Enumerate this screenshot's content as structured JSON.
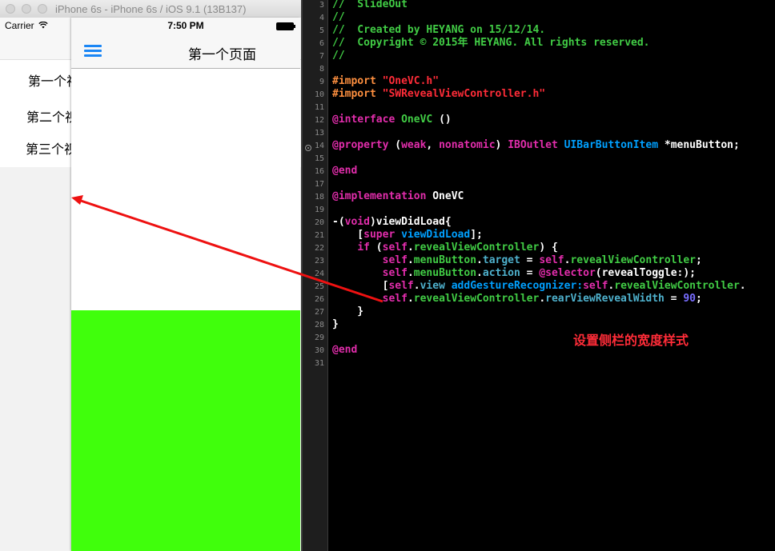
{
  "simulator": {
    "window_title": "iPhone 6s - iPhone 6s / iOS 9.1 (13B137)",
    "carrier": "Carrier",
    "time": "7:50 PM",
    "menu_items": [
      "第一个视",
      "第二个视",
      "第三个视"
    ],
    "nav_title": "第一个页面",
    "green_color": "#40ff0c",
    "menu_icon": "hamburger-menu-icon",
    "wifi_icon": "wifi-icon",
    "battery_icon": "battery-icon"
  },
  "editor": {
    "line_numbers": [
      "3",
      "4",
      "5",
      "6",
      "7",
      "8",
      "9",
      "10",
      "11",
      "12",
      "13",
      "14",
      "15",
      "16",
      "17",
      "18",
      "19",
      "20",
      "21",
      "22",
      "23",
      "24",
      "25",
      "26",
      "27",
      "28",
      "29",
      "30",
      "31"
    ],
    "lines": [
      [
        {
          "t": "//  SlideOut",
          "k": "c"
        }
      ],
      [
        {
          "t": "//",
          "k": "c"
        }
      ],
      [
        {
          "t": "//  Created by HEYANG on 15/12/14.",
          "k": "c"
        }
      ],
      [
        {
          "t": "//  Copyright © 2015年 HEYANG. All rights reserved.",
          "k": "c"
        }
      ],
      [
        {
          "t": "//",
          "k": "c"
        }
      ],
      [],
      [
        {
          "t": "#import ",
          "k": "pp"
        },
        {
          "t": "\"OneVC.h\"",
          "k": "st"
        }
      ],
      [
        {
          "t": "#import ",
          "k": "pp"
        },
        {
          "t": "\"SWRevealViewController.h\"",
          "k": "st"
        }
      ],
      [],
      [
        {
          "t": "@interface",
          "k": "kw"
        },
        {
          "t": " ",
          "k": "pl"
        },
        {
          "t": "OneVC",
          "k": "gr"
        },
        {
          "t": " ()",
          "k": "pl"
        }
      ],
      [],
      [
        {
          "t": "@property",
          "k": "kw"
        },
        {
          "t": " (",
          "k": "pl"
        },
        {
          "t": "weak",
          "k": "kw"
        },
        {
          "t": ", ",
          "k": "pl"
        },
        {
          "t": "nonatomic",
          "k": "kw"
        },
        {
          "t": ") ",
          "k": "pl"
        },
        {
          "t": "IBOutlet",
          "k": "kw"
        },
        {
          "t": " ",
          "k": "pl"
        },
        {
          "t": "UIBarButtonItem",
          "k": "cl"
        },
        {
          "t": " *menuButton;",
          "k": "pl"
        }
      ],
      [],
      [
        {
          "t": "@end",
          "k": "kw"
        }
      ],
      [],
      [
        {
          "t": "@implementation",
          "k": "kw"
        },
        {
          "t": " OneVC",
          "k": "pl"
        }
      ],
      [],
      [
        {
          "t": "-(",
          "k": "pl"
        },
        {
          "t": "void",
          "k": "kw"
        },
        {
          "t": ")viewDidLoad{",
          "k": "pl"
        }
      ],
      [
        {
          "t": "    [",
          "k": "pl"
        },
        {
          "t": "super",
          "k": "kw"
        },
        {
          "t": " ",
          "k": "pl"
        },
        {
          "t": "viewDidLoad",
          "k": "cl"
        },
        {
          "t": "];",
          "k": "pl"
        }
      ],
      [
        {
          "t": "    ",
          "k": "pl"
        },
        {
          "t": "if",
          "k": "kw"
        },
        {
          "t": " (",
          "k": "pl"
        },
        {
          "t": "self",
          "k": "kw"
        },
        {
          "t": ".",
          "k": "pl"
        },
        {
          "t": "revealViewController",
          "k": "gr"
        },
        {
          "t": ") {",
          "k": "pl"
        }
      ],
      [
        {
          "t": "        ",
          "k": "pl"
        },
        {
          "t": "self",
          "k": "kw"
        },
        {
          "t": ".",
          "k": "pl"
        },
        {
          "t": "menuButton",
          "k": "gr"
        },
        {
          "t": ".",
          "k": "pl"
        },
        {
          "t": "target",
          "k": "tp"
        },
        {
          "t": " = ",
          "k": "pl"
        },
        {
          "t": "self",
          "k": "kw"
        },
        {
          "t": ".",
          "k": "pl"
        },
        {
          "t": "revealViewController",
          "k": "gr"
        },
        {
          "t": ";",
          "k": "pl"
        }
      ],
      [
        {
          "t": "        ",
          "k": "pl"
        },
        {
          "t": "self",
          "k": "kw"
        },
        {
          "t": ".",
          "k": "pl"
        },
        {
          "t": "menuButton",
          "k": "gr"
        },
        {
          "t": ".",
          "k": "pl"
        },
        {
          "t": "action",
          "k": "tp"
        },
        {
          "t": " = ",
          "k": "pl"
        },
        {
          "t": "@selector",
          "k": "kw"
        },
        {
          "t": "(revealToggle:);",
          "k": "pl"
        }
      ],
      [
        {
          "t": "        [",
          "k": "pl"
        },
        {
          "t": "self",
          "k": "kw"
        },
        {
          "t": ".",
          "k": "pl"
        },
        {
          "t": "view",
          "k": "tp"
        },
        {
          "t": " ",
          "k": "pl"
        },
        {
          "t": "addGestureRecognizer:",
          "k": "cl"
        },
        {
          "t": "self",
          "k": "kw"
        },
        {
          "t": ".",
          "k": "pl"
        },
        {
          "t": "revealViewController",
          "k": "gr"
        },
        {
          "t": ".",
          "k": "pl"
        }
      ],
      [
        {
          "t": "        ",
          "k": "pl"
        },
        {
          "t": "self",
          "k": "kw"
        },
        {
          "t": ".",
          "k": "pl"
        },
        {
          "t": "revealViewController",
          "k": "gr"
        },
        {
          "t": ".",
          "k": "pl"
        },
        {
          "t": "rearViewRevealWidth",
          "k": "tp"
        },
        {
          "t": " = ",
          "k": "pl"
        },
        {
          "t": "90",
          "k": "nm"
        },
        {
          "t": ";",
          "k": "pl"
        }
      ],
      [
        {
          "t": "    }",
          "k": "pl"
        }
      ],
      [
        {
          "t": "}",
          "k": "pl"
        }
      ],
      [],
      [
        {
          "t": "@end",
          "k": "kw"
        }
      ],
      []
    ],
    "annotation": "设置侧栏的宽度样式",
    "annotation_color": "#ff2c38",
    "arrow_color": "#ee1111"
  }
}
